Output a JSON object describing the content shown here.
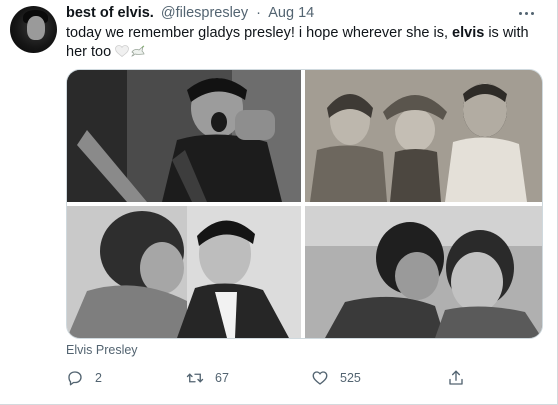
{
  "tweet": {
    "author_name": "best of elvis.",
    "handle": "@filespresley",
    "separator": "·",
    "date": "Aug 14",
    "text_before": "today we remember gladys presley! i hope wherever she is, ",
    "text_bold": "elvis",
    "text_after": " is with her too",
    "emoji": [
      "white-heart-icon",
      "dove-icon"
    ],
    "media": [
      {
        "name": "photo-elvis-singing",
        "tone": "#3c3c3c"
      },
      {
        "name": "photo-presley-family",
        "tone": "#8b857b"
      },
      {
        "name": "photo-elvis-kissed",
        "tone": "#a9a9a9"
      },
      {
        "name": "photo-elvis-kissing-gladys",
        "tone": "#7a7a7a"
      }
    ],
    "caption": "Elvis Presley",
    "actions": {
      "reply_icon": "reply-icon",
      "reply_count": "2",
      "retweet_icon": "retweet-icon",
      "retweet_count": "67",
      "like_icon": "heart-icon",
      "like_count": "525",
      "share_icon": "share-icon"
    },
    "colors": {
      "text": "#0f1419",
      "secondary": "#536471",
      "border": "#cfd9de"
    }
  }
}
